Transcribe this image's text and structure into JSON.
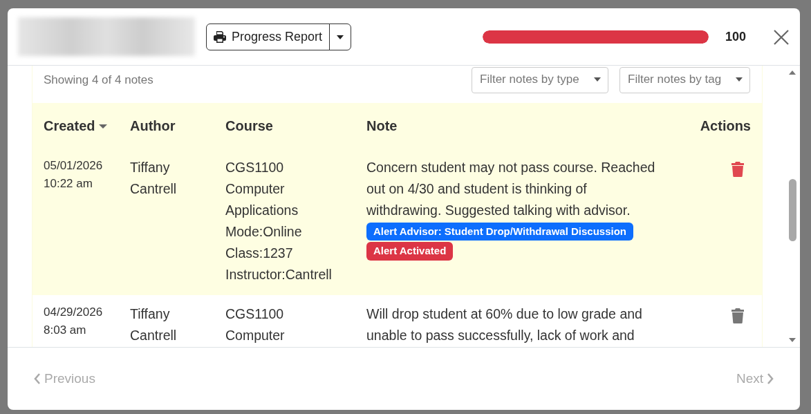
{
  "header": {
    "name_redacted": true,
    "report_button": "Progress Report",
    "score": {
      "level": 1.0,
      "reading": "100"
    }
  },
  "notes": {
    "summary": "Showing 4 of 4 notes",
    "filters": [
      {
        "placeholder": "Filter notes by type"
      },
      {
        "placeholder": "Filter notes by tag"
      }
    ],
    "columns": [
      {
        "label": "Created",
        "sorted": true
      },
      {
        "label": "Author",
        "sorted": false
      },
      {
        "label": "Course",
        "sorted": false
      },
      {
        "label": "Note",
        "sorted": false
      },
      {
        "label": "Actions",
        "sorted": false
      }
    ],
    "rows": [
      {
        "highlighted": true,
        "created": [
          "05/01/2026",
          "10:22 am"
        ],
        "author": "Tiffany Cantrell",
        "course": [
          "CGS1100",
          "Computer Applications",
          "Mode:Online",
          "Class:1237",
          "Instructor:Cantrell"
        ],
        "note": "Concern student may not pass course. Reached out on 4/30 and student is thinking of withdrawing. Suggested talking with advisor.",
        "tags": [
          {
            "label": "Alert Advisor: Student Drop/Withdrawal Discussion",
            "color": "#0d6efd"
          },
          {
            "label": "Alert Activated",
            "color": "#dc3545"
          }
        ]
      },
      {
        "highlighted": false,
        "created": [
          "04/29/2026",
          "8:03 am"
        ],
        "author": "Tiffany Cantrell",
        "course": [
          "CGS1100",
          "Computer"
        ],
        "note": "Will drop student at 60% due to low grade and unable to pass successfully, lack of work and",
        "tags": []
      }
    ]
  },
  "footer": {
    "previous": {
      "label": "Previous",
      "disabled": true
    },
    "next": {
      "label": "Next",
      "disabled": true
    }
  }
}
